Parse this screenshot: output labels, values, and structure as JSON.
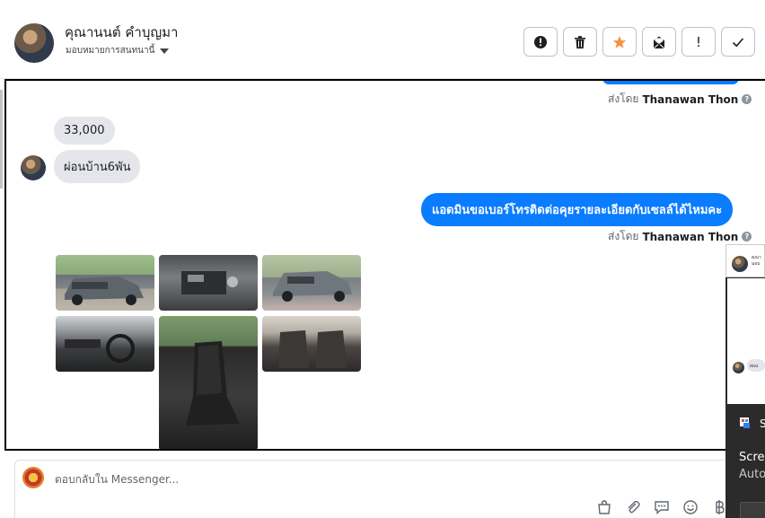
{
  "header": {
    "contact_name": "คุณานนต์ คำบุญมา",
    "assign_label": "มอบหมายการสนทนานี้"
  },
  "actions": [
    {
      "name": "alert-icon"
    },
    {
      "name": "trash-icon"
    },
    {
      "name": "star-icon",
      "color": "#f7923b"
    },
    {
      "name": "mark-unread-icon"
    },
    {
      "name": "exclamation-icon",
      "label": "!"
    },
    {
      "name": "check-icon"
    }
  ],
  "conversation": {
    "sent_by_prefix": "ส่งโดย",
    "sender_name": "Thanawan Thon",
    "help_mark": "?",
    "messages": [
      {
        "direction": "in",
        "text": "33,000"
      },
      {
        "direction": "in",
        "text": "ผ่อนบ้าน6พัน"
      },
      {
        "direction": "out",
        "text": "แอดมินขอเบอร์โทรติดต่อคุยรายละเอียดกับเซลล์ได้ไหมคะ"
      }
    ],
    "photos_count_label": ""
  },
  "composer": {
    "placeholder": "ตอบกลับใน Messenger..."
  },
  "toolbar_icons": [
    "bag-icon",
    "paperclip-icon",
    "saved-reply-icon",
    "emoji-icon",
    "baht-icon"
  ],
  "overlay": {
    "mini_name": "คุณา",
    "mini_sub": "มอบ",
    "mini_bubble": "ผ่อน",
    "label": "S",
    "line1": "Scree",
    "line2": "Auto"
  },
  "colors": {
    "accent": "#0a7cff",
    "star": "#f7923b"
  }
}
